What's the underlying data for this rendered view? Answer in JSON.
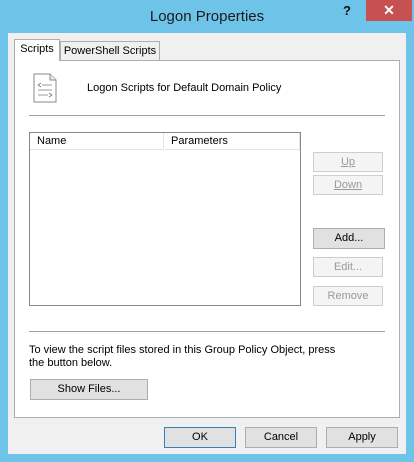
{
  "window": {
    "title": "Logon Properties",
    "help_glyph": "?",
    "close_glyph": "✕"
  },
  "tabs": [
    {
      "label": "Scripts",
      "selected": true
    },
    {
      "label": "PowerShell Scripts",
      "selected": false
    }
  ],
  "header": {
    "icon": "script-document-icon",
    "label": "Logon Scripts for Default Domain Policy"
  },
  "list": {
    "columns": [
      "Name",
      "Parameters"
    ],
    "rows": []
  },
  "side_buttons": {
    "up": "Up",
    "down": "Down",
    "add": "Add...",
    "edit": "Edit...",
    "remove": "Remove"
  },
  "info": {
    "text": "To view the script files stored in this Group Policy Object, press the button below.",
    "show_files": "Show Files..."
  },
  "footer": {
    "ok": "OK",
    "cancel": "Cancel",
    "apply": "Apply"
  },
  "colors": {
    "frame": "#6ec3e8",
    "close": "#c75050",
    "default_button_border": "#3c7fb1"
  }
}
